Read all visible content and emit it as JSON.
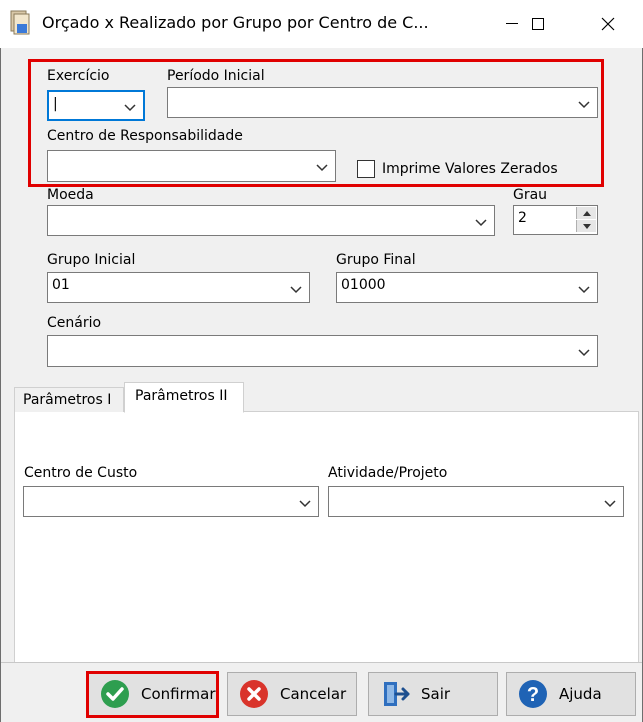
{
  "window": {
    "title": "Orçado x Realizado por Grupo por Centro de C...",
    "minimize_glyph": "—",
    "maximize_glyph": "☐",
    "close_glyph": "✕"
  },
  "form": {
    "exercicio_label": "Exercício",
    "exercicio_value": "|",
    "periodo_inicial_label": "Período Inicial",
    "periodo_inicial_value": "",
    "centro_resp_label": "Centro de Responsabilidade",
    "centro_resp_value": "",
    "imprime_zerados_label": "Imprime Valores Zerados",
    "imprime_zerados_checked": false,
    "moeda_label": "Moeda",
    "moeda_value": "",
    "grau_label": "Grau",
    "grau_value": "2",
    "grupo_inicial_label": "Grupo Inicial",
    "grupo_inicial_value": "01",
    "grupo_final_label": "Grupo Final",
    "grupo_final_value": "01000",
    "cenario_label": "Cenário",
    "cenario_value": ""
  },
  "tabs": [
    {
      "label": "Parâmetros I",
      "active": false
    },
    {
      "label": "Parâmetros II",
      "active": true
    }
  ],
  "tab2": {
    "centro_custo_label": "Centro de Custo",
    "centro_custo_value": "",
    "atividade_label": "Atividade/Projeto",
    "atividade_value": ""
  },
  "buttons": {
    "confirmar": "Confirmar",
    "cancelar": "Cancelar",
    "sair": "Sair",
    "ajuda": "Ajuda"
  },
  "colors": {
    "highlight_red": "#e00000",
    "confirm_green": "#2e9e4f",
    "cancel_red": "#d9342b",
    "help_blue": "#1f63b5"
  },
  "icons": {
    "app": "report-document-icon",
    "confirm": "check-circle-icon",
    "cancel": "x-circle-icon",
    "exit": "door-exit-icon",
    "help": "question-circle-icon"
  }
}
